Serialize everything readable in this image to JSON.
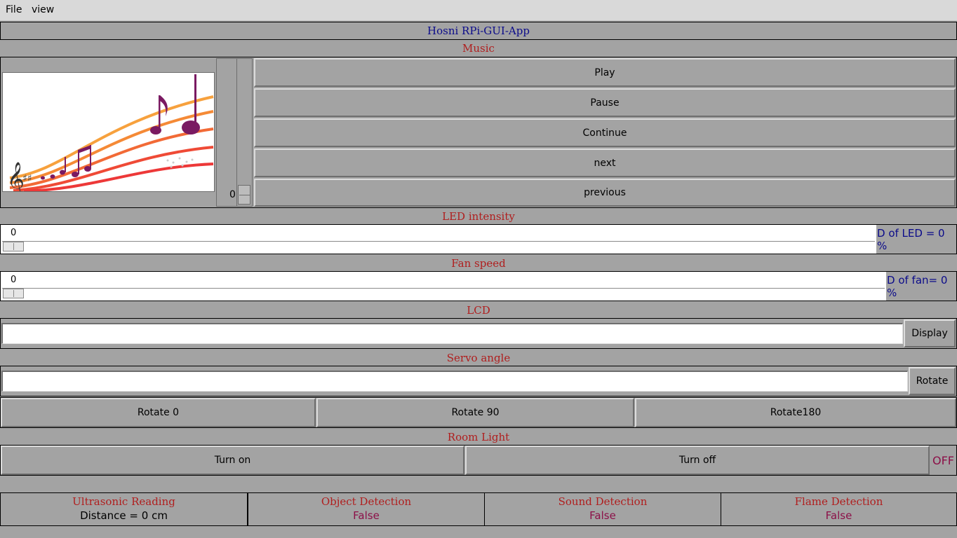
{
  "menu": {
    "items": [
      "File",
      "view"
    ]
  },
  "app_title": "Hosni RPi-GUI-App",
  "music": {
    "label": "Music",
    "volume_value": "0",
    "buttons": [
      "Play",
      "Pause",
      "Continue",
      "next",
      "previous"
    ]
  },
  "led": {
    "label": "LED intensity",
    "value": "0",
    "status": "D of LED = 0 %"
  },
  "fan": {
    "label": "Fan speed",
    "value": "0",
    "status": "D of fan= 0 %"
  },
  "lcd": {
    "label": "LCD",
    "input_value": "",
    "button": "Display"
  },
  "servo": {
    "label": "Servo angle",
    "input_value": "",
    "rotate_button": "Rotate",
    "presets": [
      "Rotate 0",
      "Rotate 90",
      "Rotate180"
    ]
  },
  "room_light": {
    "label": "Room Light",
    "on_button": "Turn on",
    "off_button": "Turn off",
    "status": "OFF"
  },
  "sensors": [
    {
      "title": "Ultrasonic Reading",
      "value": "Distance = 0 cm"
    },
    {
      "title": "Object Detection",
      "value": "False"
    },
    {
      "title": "Sound Detection",
      "value": "False"
    },
    {
      "title": "Flame Detection",
      "value": "False"
    }
  ],
  "colors": {
    "background": "#a3a3a3",
    "label_red": "#b01e1e",
    "title_navy": "#0b0b8a",
    "status_maroon": "#8c1048"
  }
}
